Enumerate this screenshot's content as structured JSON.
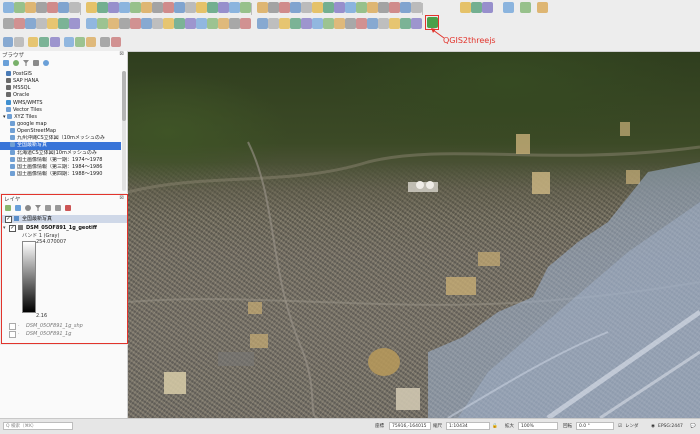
{
  "annotation": {
    "label": "QGIS2threejs"
  },
  "browser": {
    "title": "ブラウザ",
    "items": [
      {
        "label": "PostGIS",
        "icon": "elephant-icon"
      },
      {
        "label": "SAP HANA",
        "icon": "database-icon"
      },
      {
        "label": "MSSQL",
        "icon": "database-icon"
      },
      {
        "label": "Oracle",
        "icon": "database-icon"
      },
      {
        "label": "WMS/WMTS",
        "icon": "globe-icon"
      },
      {
        "label": "Vector Tiles",
        "icon": "grid-icon"
      },
      {
        "label": "XYZ Tiles",
        "icon": "grid-icon"
      },
      {
        "label": "google map",
        "icon": "grid-icon"
      },
      {
        "label": "OpenStreetMap",
        "icon": "grid-icon"
      },
      {
        "label": "九州沖縄CS立体図（10mメッシュのみ",
        "icon": "grid-icon"
      },
      {
        "label": "全国最新写真",
        "icon": "grid-icon"
      },
      {
        "label": "北海道CS立体図(10mメッシュのみ",
        "icon": "grid-icon"
      },
      {
        "label": "国土画像情報（第一期：1974〜1978",
        "icon": "grid-icon"
      },
      {
        "label": "国土画像情報（第三期：1984〜1986",
        "icon": "grid-icon"
      },
      {
        "label": "国土画像情報（第四期：1988〜1990",
        "icon": "grid-icon"
      }
    ]
  },
  "layers": {
    "title": "レイヤ",
    "items": [
      {
        "label": "全国最新写真",
        "checked": true
      },
      {
        "label": "DSM_05OF891_1g_geotiff",
        "checked": true
      }
    ],
    "band": "バンド 1 (Gray)",
    "max": "254.070007",
    "min": "2.16",
    "extra": [
      {
        "label": "DSM_05OF891_1g_shp"
      },
      {
        "label": "DSM_05OF891_1g"
      }
    ]
  },
  "status": {
    "search_placeholder": "Q 検索（⌘K）",
    "coord_label": "座標",
    "coord_value": "75916,-164015",
    "scale_label": "縮尺",
    "scale_value": "1:10434",
    "mag_label": "拡大",
    "mag_value": "100%",
    "rot_label": "回転",
    "rot_value": "0.0 °",
    "render_label": "レンダ",
    "crs": "EPSG:2447"
  },
  "colors": {
    "accent": "#e2342c",
    "selection": "#3874d8"
  }
}
